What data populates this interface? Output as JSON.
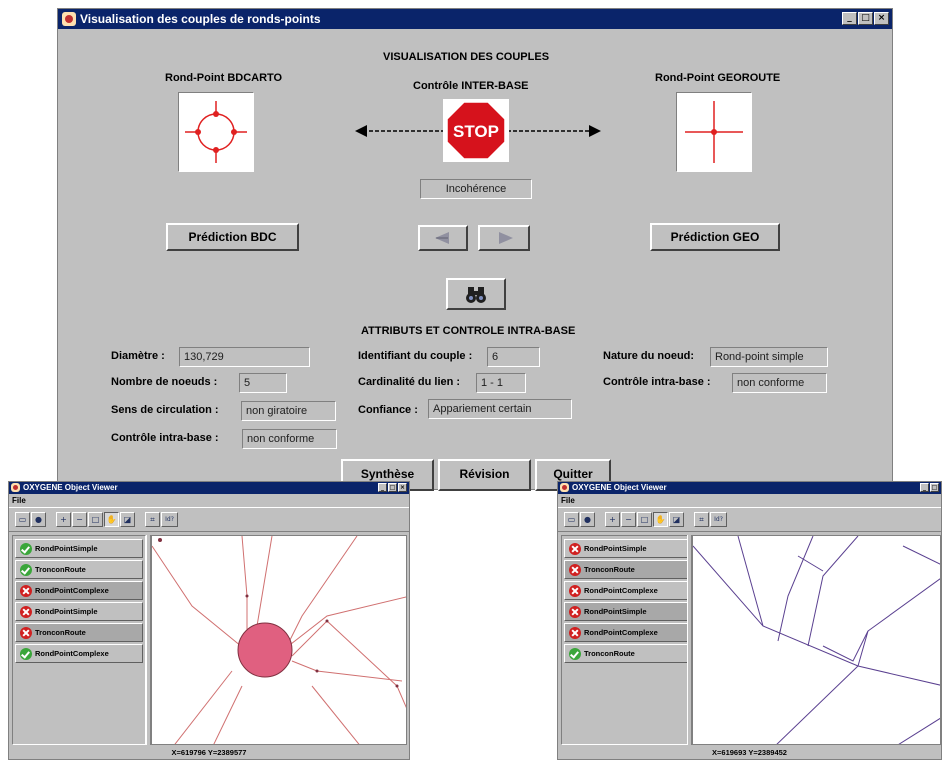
{
  "main": {
    "title": "Visualisation des couples de ronds-points",
    "heading": "VISUALISATION DES COUPLES",
    "left_header": "Rond-Point BDCARTO",
    "center_header": "Contrôle INTER-BASE",
    "right_header": "Rond-Point GEOROUTE",
    "stop_text": "STOP",
    "status_field": "Incohérence",
    "prediction_bdc": "Prédiction BDC",
    "prediction_geo": "Prédiction GEO",
    "attr_heading": "ATTRIBUTS ET CONTROLE INTRA-BASE",
    "attrs": {
      "diametre_label": "Diamètre :",
      "diametre_value": "130,729",
      "nb_noeuds_label": "Nombre de noeuds :",
      "nb_noeuds_value": "5",
      "sens_label": "Sens de circulation :",
      "sens_value": "non giratoire",
      "controle_left_label": "Contrôle intra-base :",
      "controle_left_value": "non conforme",
      "identifiant_label": "Identifiant du couple :",
      "identifiant_value": "6",
      "cardinalite_label": "Cardinalité du lien :",
      "cardinalite_value": "1 - 1",
      "confiance_label": "Confiance :",
      "confiance_value": "Appariement certain",
      "nature_label": "Nature du noeud:",
      "nature_value": "Rond-point simple",
      "controle_right_label": "Contrôle intra-base :",
      "controle_right_value": "non conforme"
    },
    "buttons": {
      "synthese": "Synthèse",
      "revision": "Révision",
      "quitter": "Quitter"
    },
    "colors": {
      "titlebar": "#0a246a",
      "window": "#c0c0c0",
      "stop": "#d6121c",
      "feature": "#e02020"
    }
  },
  "viewer_left": {
    "title": "OXYGENE Object Viewer",
    "menu_file": "File",
    "toolbar_text": "Id?",
    "layers": [
      {
        "label": "RondPointSimple",
        "status": "ok"
      },
      {
        "label": "TronconRoute",
        "status": "ok"
      },
      {
        "label": "RondPointComplexe",
        "status": "ko"
      },
      {
        "label": "RondPointSimple",
        "status": "ko"
      },
      {
        "label": "TronconRoute",
        "status": "ko"
      },
      {
        "label": "RondPointComplexe",
        "status": "ok"
      }
    ],
    "status": "X=619796 Y=2389577"
  },
  "viewer_right": {
    "title": "OXYGENE Object Viewer",
    "menu_file": "File",
    "toolbar_text": "Id?",
    "layers": [
      {
        "label": "RondPointSimple",
        "status": "ko"
      },
      {
        "label": "TronconRoute",
        "status": "ko"
      },
      {
        "label": "RondPointComplexe",
        "status": "ko"
      },
      {
        "label": "RondPointSimple",
        "status": "ko"
      },
      {
        "label": "RondPointComplexe",
        "status": "ko"
      },
      {
        "label": "TronconRoute",
        "status": "ok"
      }
    ],
    "status": "X=619693 Y=2389452"
  }
}
